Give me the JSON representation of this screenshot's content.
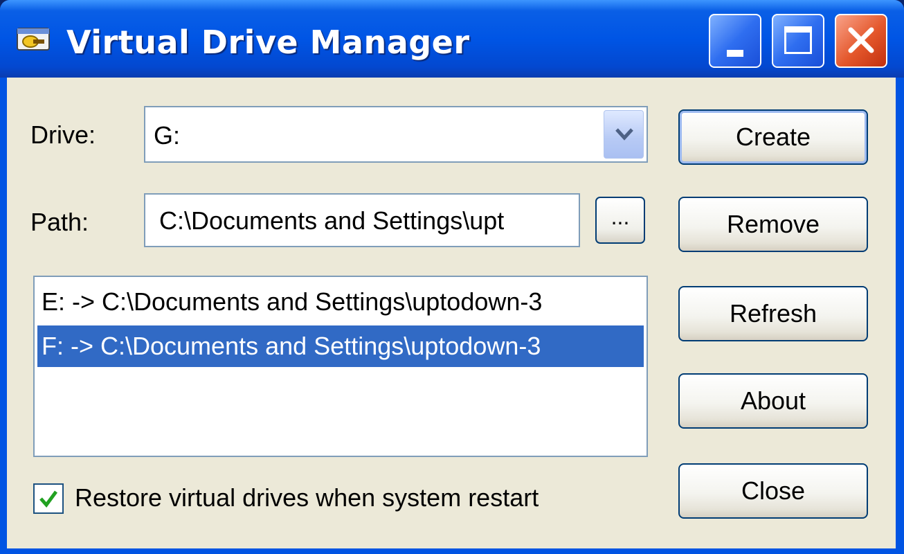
{
  "window": {
    "title": "Virtual Drive Manager",
    "icon": "drive-manager-app-icon",
    "controls": {
      "minimize": "minimize-icon",
      "maximize": "maximize-icon",
      "close": "close-icon"
    }
  },
  "form": {
    "drive_label": "Drive:",
    "drive_value": "G:",
    "path_label": "Path:",
    "path_value": "C:\\Documents and Settings\\upt",
    "browse_label": "..."
  },
  "drives": [
    {
      "text": "E: -> C:\\Documents and Settings\\uptodown-3",
      "selected": false
    },
    {
      "text": "F: -> C:\\Documents and Settings\\uptodown-3",
      "selected": true
    }
  ],
  "restore_option": {
    "label": "Restore virtual drives when system restart",
    "checked": true
  },
  "buttons": {
    "create": "Create",
    "remove": "Remove",
    "refresh": "Refresh",
    "about": "About",
    "close": "Close"
  },
  "colors": {
    "titlebar": "#0055e5",
    "selection": "#316ac5",
    "dialog_bg": "#ece9d8",
    "close_button": "#e4572b"
  }
}
